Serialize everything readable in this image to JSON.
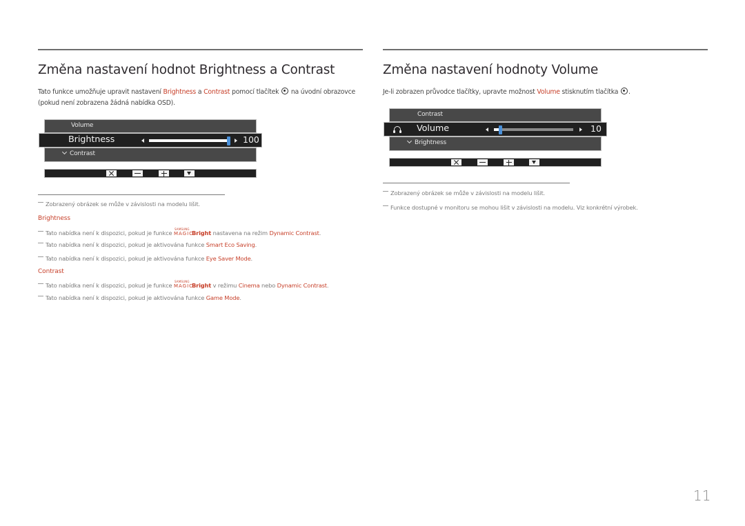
{
  "left": {
    "title": "Změna nastavení hodnot Brightness a Contrast",
    "intro": {
      "t1": "Tato funkce umožňuje upravit nastavení ",
      "hl1": "Brightness",
      "t2": " a ",
      "hl2": "Contrast",
      "t3": " pomocí tlačítek ",
      "t4": " na úvodní obrazovce",
      "line2": "(pokud není zobrazena žádná nabídka OSD)."
    },
    "osd": {
      "row_above": "Volume",
      "active": "Brightness",
      "row_below": "Contrast",
      "value": "100",
      "slider_fraction": 1.0
    },
    "notes": {
      "image_note": "Zobrazený obrázek se může v závislosti na modelu lišit.",
      "brightness_heading": "Brightness",
      "brightness_notes": [
        {
          "pre": "Tato nabídka není k dispozici, pokud je funkce ",
          "magic": true,
          "mid": " nastavena na režim ",
          "hl": "Dynamic Contrast",
          "post": "."
        },
        {
          "pre": "Tato nabídka není k dispozici, pokud je aktivována funkce ",
          "hl": "Smart Eco Saving",
          "post": "."
        },
        {
          "pre": "Tato nabídka není k dispozici, pokud je aktivována funkce ",
          "hl": "Eye Saver Mode",
          "post": "."
        }
      ],
      "contrast_heading": "Contrast",
      "contrast_notes": [
        {
          "pre": "Tato nabídka není k dispozici, pokud je funkce ",
          "magic": true,
          "mid": " v režimu ",
          "hl": "Cinema",
          "mid2": " nebo ",
          "hl2": "Dynamic Contrast",
          "post": "."
        },
        {
          "pre": "Tato nabídka není k dispozici, pokud je aktivována funkce ",
          "hl": "Game Mode",
          "post": "."
        }
      ]
    }
  },
  "right": {
    "title": "Změna nastavení hodnoty Volume",
    "intro": {
      "t1": "Je-li zobrazen průvodce tlačítky, upravte možnost ",
      "hl1": "Volume",
      "t2": " stisknutím tlačítka ",
      "t3": "."
    },
    "osd": {
      "row_above": "Contrast",
      "active": "Volume",
      "row_below": "Brightness",
      "value": "10",
      "slider_fraction": 0.1
    },
    "notes": [
      "Zobrazený obrázek se může v závislosti na modelu lišit.",
      "Funkce dostupné v monitoru se mohou lišit v závislosti na modelu. Viz konkrétní výrobek."
    ]
  },
  "magic_logo": {
    "samsung": "SAMSUNG",
    "magic": "MAGIC",
    "bright": "Bright"
  },
  "guide_buttons": [
    "close",
    "minus",
    "plus",
    "down"
  ],
  "icons": {
    "joystick": "circle-dot-icon",
    "headphone": "headphone-icon"
  },
  "colors": {
    "accent": "#c7402a",
    "osd_bg": "#484848",
    "osd_active_bg": "#202020",
    "slider_thumb": "#4a90d9"
  },
  "page_number": "11"
}
